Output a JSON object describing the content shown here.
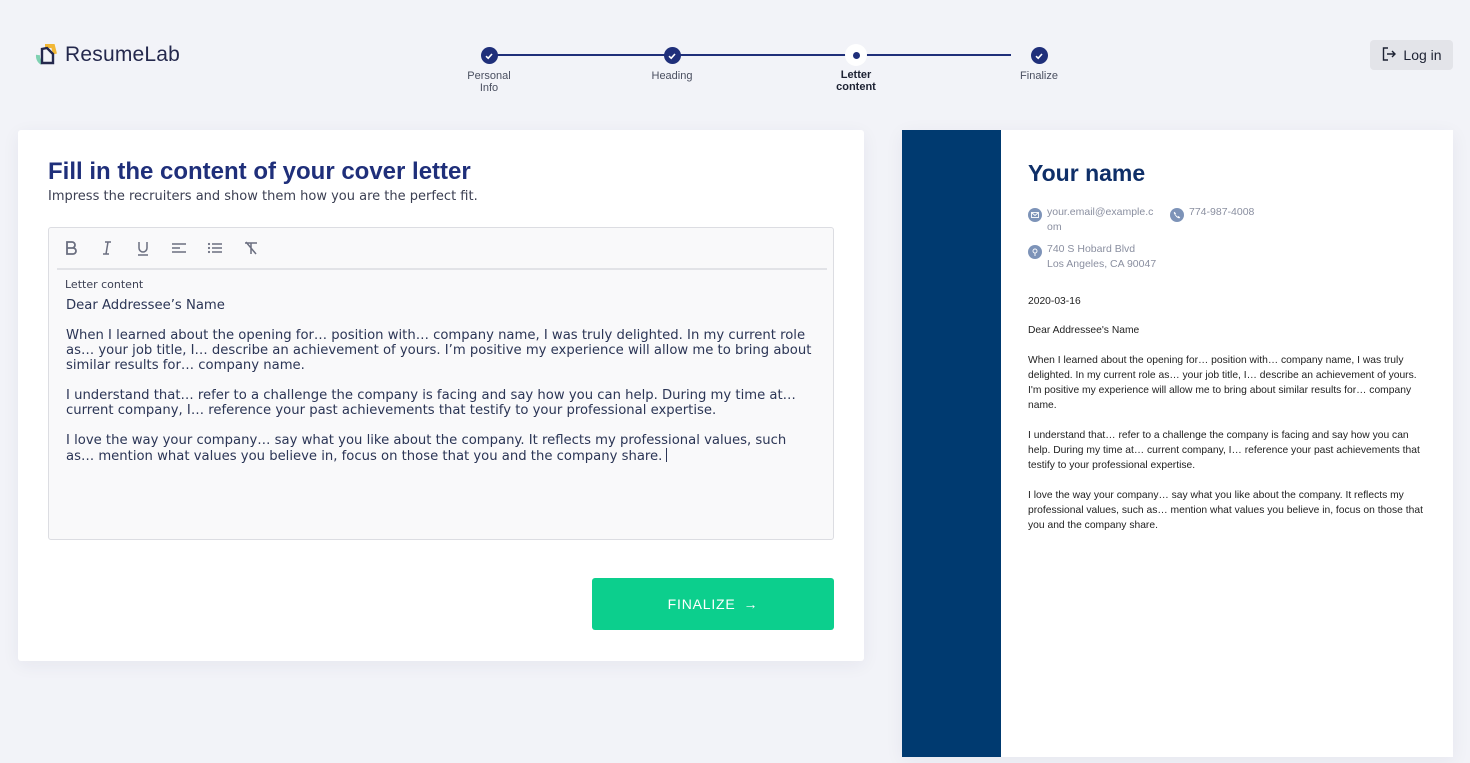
{
  "brand": {
    "name": "ResumeLab"
  },
  "header": {
    "login_label": "Log in"
  },
  "stepper": {
    "steps": [
      {
        "label_line1": "Personal",
        "label_line2": "Info",
        "state": "done"
      },
      {
        "label_line1": "Heading",
        "label_line2": "",
        "state": "done"
      },
      {
        "label_line1": "Letter",
        "label_line2": "content",
        "state": "current"
      },
      {
        "label_line1": "Finalize",
        "label_line2": "",
        "state": "done"
      }
    ]
  },
  "form": {
    "title": "Fill in the content of your cover letter",
    "subtitle": "Impress the recruiters and show them how you are the perfect fit.",
    "editor": {
      "toolbar": [
        "bold",
        "italic",
        "underline",
        "align-left",
        "bullet-list",
        "clear-format"
      ],
      "label": "Letter content",
      "paragraphs": [
        "Dear Addressee’s Name",
        "When I learned about the opening for… position with… company name, I was truly delighted. In my current role as… your job title, I… describe an achievement of yours. I’m positive my experience will allow me to bring about similar results for… company name.",
        "I understand that… refer to a challenge the company is facing and say how you can help. During my time at… current company, I… reference your past achievements that testify to your professional expertise.",
        "I love the way your company… say what you like about the company. It reflects my professional values, such as… mention what values you believe in, focus on those that you and the company share."
      ]
    },
    "finalize_label": "FINALIZE",
    "finalize_arrow": "→"
  },
  "preview": {
    "name": "Your name",
    "email": "your.email@example.com",
    "phone": "774-987-4008",
    "address_line1": "740 S Hobard Blvd",
    "address_line2": "Los Angeles, CA 90047",
    "date": "2020-03-16",
    "greeting": "Dear Addressee's Name",
    "paragraphs": [
      "When I learned about the opening for… position with… company name, I was truly delighted. In my current role as… your job title, I… describe an achievement of yours. I'm positive my experience will allow me to bring about similar results for… company name.",
      "I understand that… refer to a challenge the company is facing and say how you can help. During my time at… current company, I… reference your past achievements that testify to your professional expertise.",
      "I love the way your company… say what you like about the company. It reflects my professional values, such as… mention what values you believe in, focus on those that you and the company share."
    ],
    "accent_color": "#003a70"
  },
  "colors": {
    "primary": "#1f2f7a",
    "cta": "#0ccf8d",
    "background": "#f2f3f8"
  }
}
